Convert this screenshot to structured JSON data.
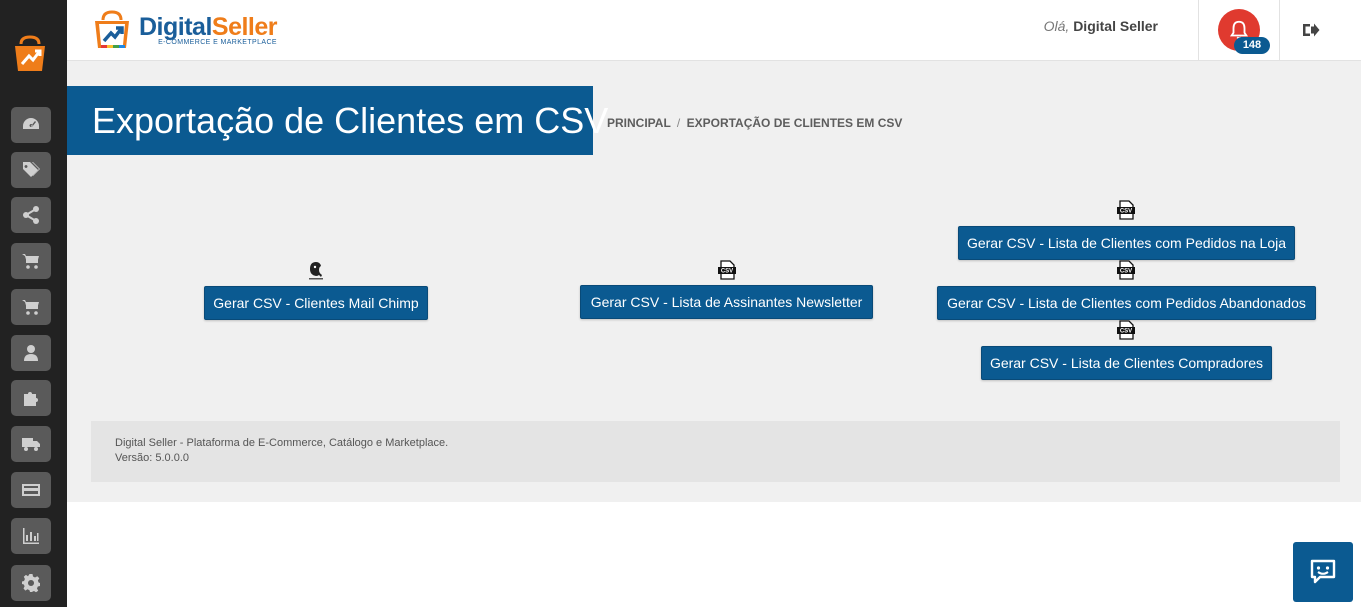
{
  "sidebar": {
    "items": [
      {
        "icon": "dashboard-icon"
      },
      {
        "icon": "tags-icon"
      },
      {
        "icon": "share-icon"
      },
      {
        "icon": "cart-icon"
      },
      {
        "icon": "cart-icon"
      },
      {
        "icon": "user-icon"
      },
      {
        "icon": "puzzle-icon"
      },
      {
        "icon": "truck-icon"
      },
      {
        "icon": "credit-card-icon"
      },
      {
        "icon": "bar-chart-icon"
      },
      {
        "icon": "gear-icon"
      }
    ]
  },
  "header": {
    "brand_digital": "Digital",
    "brand_seller": "Seller",
    "brand_tagline": "E-COMMERCE E MARKETPLACE",
    "greeting_prefix": "Olá,",
    "user_name": "Digital Seller",
    "notification_count": "148"
  },
  "page": {
    "title": "Exportação de Clientes em CSV",
    "breadcrumb": {
      "home": "PRINCIPAL",
      "separator": "/",
      "current": "EXPORTAÇÃO DE CLIENTES EM CSV"
    }
  },
  "actions": {
    "mailchimp": "Gerar CSV - Clientes Mail Chimp",
    "newsletter": "Gerar CSV - Lista de Assinantes Newsletter",
    "orders_store": "Gerar CSV - Lista de Clientes com Pedidos na Loja",
    "orders_abandoned": "Gerar CSV - Lista de Clientes com Pedidos Abandonados",
    "buyers": "Gerar CSV - Lista de Clientes Compradores"
  },
  "footer": {
    "line1": "Digital Seller - Plataforma de E-Commerce, Catálogo e Marketplace.",
    "line2": "Versão: 5.0.0.0"
  },
  "colors": {
    "primary": "#0b5a91",
    "accent_orange": "#ef7d1a",
    "notification_red": "#e03a2f",
    "sidebar_bg": "#222222"
  }
}
